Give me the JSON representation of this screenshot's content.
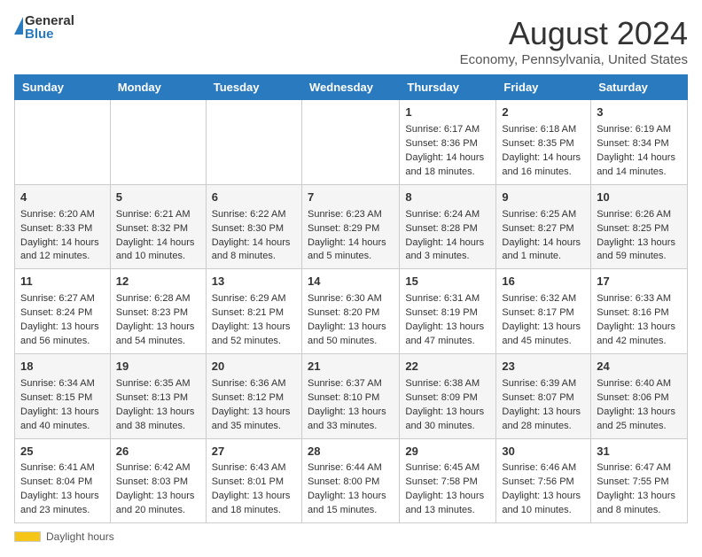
{
  "header": {
    "logo_general": "General",
    "logo_blue": "Blue",
    "main_title": "August 2024",
    "subtitle": "Economy, Pennsylvania, United States"
  },
  "days_of_week": [
    "Sunday",
    "Monday",
    "Tuesday",
    "Wednesday",
    "Thursday",
    "Friday",
    "Saturday"
  ],
  "weeks": [
    [
      {
        "day": "",
        "info": ""
      },
      {
        "day": "",
        "info": ""
      },
      {
        "day": "",
        "info": ""
      },
      {
        "day": "",
        "info": ""
      },
      {
        "day": "1",
        "info": "Sunrise: 6:17 AM\nSunset: 8:36 PM\nDaylight: 14 hours and 18 minutes."
      },
      {
        "day": "2",
        "info": "Sunrise: 6:18 AM\nSunset: 8:35 PM\nDaylight: 14 hours and 16 minutes."
      },
      {
        "day": "3",
        "info": "Sunrise: 6:19 AM\nSunset: 8:34 PM\nDaylight: 14 hours and 14 minutes."
      }
    ],
    [
      {
        "day": "4",
        "info": "Sunrise: 6:20 AM\nSunset: 8:33 PM\nDaylight: 14 hours and 12 minutes."
      },
      {
        "day": "5",
        "info": "Sunrise: 6:21 AM\nSunset: 8:32 PM\nDaylight: 14 hours and 10 minutes."
      },
      {
        "day": "6",
        "info": "Sunrise: 6:22 AM\nSunset: 8:30 PM\nDaylight: 14 hours and 8 minutes."
      },
      {
        "day": "7",
        "info": "Sunrise: 6:23 AM\nSunset: 8:29 PM\nDaylight: 14 hours and 5 minutes."
      },
      {
        "day": "8",
        "info": "Sunrise: 6:24 AM\nSunset: 8:28 PM\nDaylight: 14 hours and 3 minutes."
      },
      {
        "day": "9",
        "info": "Sunrise: 6:25 AM\nSunset: 8:27 PM\nDaylight: 14 hours and 1 minute."
      },
      {
        "day": "10",
        "info": "Sunrise: 6:26 AM\nSunset: 8:25 PM\nDaylight: 13 hours and 59 minutes."
      }
    ],
    [
      {
        "day": "11",
        "info": "Sunrise: 6:27 AM\nSunset: 8:24 PM\nDaylight: 13 hours and 56 minutes."
      },
      {
        "day": "12",
        "info": "Sunrise: 6:28 AM\nSunset: 8:23 PM\nDaylight: 13 hours and 54 minutes."
      },
      {
        "day": "13",
        "info": "Sunrise: 6:29 AM\nSunset: 8:21 PM\nDaylight: 13 hours and 52 minutes."
      },
      {
        "day": "14",
        "info": "Sunrise: 6:30 AM\nSunset: 8:20 PM\nDaylight: 13 hours and 50 minutes."
      },
      {
        "day": "15",
        "info": "Sunrise: 6:31 AM\nSunset: 8:19 PM\nDaylight: 13 hours and 47 minutes."
      },
      {
        "day": "16",
        "info": "Sunrise: 6:32 AM\nSunset: 8:17 PM\nDaylight: 13 hours and 45 minutes."
      },
      {
        "day": "17",
        "info": "Sunrise: 6:33 AM\nSunset: 8:16 PM\nDaylight: 13 hours and 42 minutes."
      }
    ],
    [
      {
        "day": "18",
        "info": "Sunrise: 6:34 AM\nSunset: 8:15 PM\nDaylight: 13 hours and 40 minutes."
      },
      {
        "day": "19",
        "info": "Sunrise: 6:35 AM\nSunset: 8:13 PM\nDaylight: 13 hours and 38 minutes."
      },
      {
        "day": "20",
        "info": "Sunrise: 6:36 AM\nSunset: 8:12 PM\nDaylight: 13 hours and 35 minutes."
      },
      {
        "day": "21",
        "info": "Sunrise: 6:37 AM\nSunset: 8:10 PM\nDaylight: 13 hours and 33 minutes."
      },
      {
        "day": "22",
        "info": "Sunrise: 6:38 AM\nSunset: 8:09 PM\nDaylight: 13 hours and 30 minutes."
      },
      {
        "day": "23",
        "info": "Sunrise: 6:39 AM\nSunset: 8:07 PM\nDaylight: 13 hours and 28 minutes."
      },
      {
        "day": "24",
        "info": "Sunrise: 6:40 AM\nSunset: 8:06 PM\nDaylight: 13 hours and 25 minutes."
      }
    ],
    [
      {
        "day": "25",
        "info": "Sunrise: 6:41 AM\nSunset: 8:04 PM\nDaylight: 13 hours and 23 minutes."
      },
      {
        "day": "26",
        "info": "Sunrise: 6:42 AM\nSunset: 8:03 PM\nDaylight: 13 hours and 20 minutes."
      },
      {
        "day": "27",
        "info": "Sunrise: 6:43 AM\nSunset: 8:01 PM\nDaylight: 13 hours and 18 minutes."
      },
      {
        "day": "28",
        "info": "Sunrise: 6:44 AM\nSunset: 8:00 PM\nDaylight: 13 hours and 15 minutes."
      },
      {
        "day": "29",
        "info": "Sunrise: 6:45 AM\nSunset: 7:58 PM\nDaylight: 13 hours and 13 minutes."
      },
      {
        "day": "30",
        "info": "Sunrise: 6:46 AM\nSunset: 7:56 PM\nDaylight: 13 hours and 10 minutes."
      },
      {
        "day": "31",
        "info": "Sunrise: 6:47 AM\nSunset: 7:55 PM\nDaylight: 13 hours and 8 minutes."
      }
    ]
  ],
  "footer": {
    "daylight_label": "Daylight hours"
  }
}
